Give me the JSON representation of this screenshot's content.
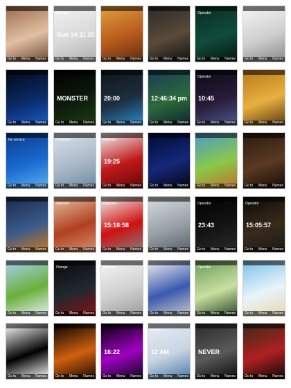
{
  "grid": {
    "tiles": [
      {
        "name": "tile-woman-bikini",
        "bg": [
          "#9a6b4c",
          "#e2c0a4",
          "#6f4a35"
        ],
        "operator": "",
        "text": "",
        "softkeys": false
      },
      {
        "name": "tile-heart-calendar",
        "bg": [
          "#f2f2f2",
          "#d9d9d9",
          "#b0b0b0"
        ],
        "operator": "Operator",
        "text": "Sun 14:11 2010",
        "softkeys": false
      },
      {
        "name": "tile-autumn-leaves",
        "bg": [
          "#e0a040",
          "#b85a1c",
          "#5a2c10"
        ],
        "operator": "",
        "text": "",
        "softkeys": false
      },
      {
        "name": "tile-matches",
        "bg": [
          "#2a2a2a",
          "#5a4a3a",
          "#111111"
        ],
        "operator": "",
        "text": "",
        "softkeys": false
      },
      {
        "name": "tile-green-clock",
        "bg": [
          "#0a2a22",
          "#0f4c3c",
          "#051510"
        ],
        "operator": "Operator",
        "text": "",
        "softkeys": false
      },
      {
        "name": "tile-paper-sketch",
        "bg": [
          "#f5f5f5",
          "#cfcfcf",
          "#8a8a8a"
        ],
        "operator": "",
        "text": "",
        "softkeys": false
      },
      {
        "name": "tile-blue-battery",
        "bg": [
          "#040814",
          "#0a2a66",
          "#1a5ccc"
        ],
        "operator": "",
        "text": "",
        "softkeys": false
      },
      {
        "name": "tile-monster-energy",
        "bg": [
          "#000000",
          "#0d1a0d",
          "#1b3d12"
        ],
        "operator": "",
        "text": "MONSTER",
        "softkeys": false
      },
      {
        "name": "tile-blue-lens",
        "bg": [
          "#101418",
          "#1d2f3f",
          "#2a8ad0"
        ],
        "operator": "",
        "text": "20:00",
        "softkeys": false
      },
      {
        "name": "tile-palm-windows",
        "bg": [
          "#1a3a55",
          "#2c6a3a",
          "#0d2230"
        ],
        "operator": "",
        "text": "12:46:34 pm",
        "softkeys": false
      },
      {
        "name": "tile-dark-skull",
        "bg": [
          "#0a0a14",
          "#2a1a3a",
          "#4a5a8a"
        ],
        "operator": "Operator",
        "text": "10:45",
        "softkeys": false
      },
      {
        "name": "tile-anime-orange",
        "bg": [
          "#b8781c",
          "#e8b040",
          "#5a3a10"
        ],
        "operator": "",
        "text": "",
        "softkeys": false
      },
      {
        "name": "tile-dolphin",
        "bg": [
          "#0a3a8a",
          "#1a6ad0",
          "#5ab0f0"
        ],
        "operator": "No service",
        "text": "",
        "softkeys": false
      },
      {
        "name": "tile-vodafone-clock",
        "bg": [
          "#d8e2ea",
          "#aab8c8",
          "#6f8aa0"
        ],
        "operator": "Vodafone",
        "text": "",
        "softkeys": false
      },
      {
        "name": "tile-red-heart",
        "bg": [
          "#f2f2f2",
          "#c01818",
          "#600808"
        ],
        "operator": "Operator",
        "text": "19:25",
        "softkeys": false
      },
      {
        "name": "tile-blue-gauges",
        "bg": [
          "#000a30",
          "#14287a",
          "#05050f"
        ],
        "operator": "",
        "text": "",
        "softkeys": false
      },
      {
        "name": "tile-fantasy-girl",
        "bg": [
          "#4a9acc",
          "#8ac84a",
          "#c0702a"
        ],
        "operator": "",
        "text": "",
        "softkeys": false
      },
      {
        "name": "tile-brown-clock",
        "bg": [
          "#2a1a10",
          "#5a3a22",
          "#140a05"
        ],
        "operator": "",
        "text": "",
        "softkeys": false
      },
      {
        "name": "tile-motorbike",
        "bg": [
          "#1a2a4a",
          "#3a5a8a",
          "#c87a20"
        ],
        "operator": "",
        "text": "",
        "softkeys": false
      },
      {
        "name": "tile-girl-redhead",
        "bg": [
          "#e8c0a0",
          "#b04020",
          "#d89070"
        ],
        "operator": "Operator",
        "text": "",
        "softkeys": false
      },
      {
        "name": "tile-ferrari",
        "bg": [
          "#f0f0f0",
          "#d01010",
          "#808080"
        ],
        "operator": "Operator",
        "text": "15:18:58",
        "softkeys": false
      },
      {
        "name": "tile-smoke-train",
        "bg": [
          "#d8dce0",
          "#9aa0a8",
          "#5a6068"
        ],
        "operator": "",
        "text": "",
        "softkeys": false
      },
      {
        "name": "tile-black-clock",
        "bg": [
          "#000000",
          "#141414",
          "#2a2a2a"
        ],
        "operator": "Operator",
        "text": "23:43",
        "softkeys": false
      },
      {
        "name": "tile-warrior",
        "bg": [
          "#0a0a0a",
          "#3a2a1a",
          "#1a1a1a"
        ],
        "operator": "Operator",
        "text": "15:05:57",
        "softkeys": false
      },
      {
        "name": "tile-grass-blue",
        "bg": [
          "#a8d0f0",
          "#6ab03a",
          "#e8f0f8"
        ],
        "operator": "",
        "text": "",
        "softkeys": false
      },
      {
        "name": "tile-speedometer",
        "bg": [
          "#0a0a0a",
          "#202830",
          "#8a1010"
        ],
        "operator": "Orange",
        "text": "",
        "softkeys": false
      },
      {
        "name": "tile-alarm-clock",
        "bg": [
          "#f5f5f5",
          "#d0d0d0",
          "#9a9a9a"
        ],
        "operator": "Operator",
        "text": "",
        "softkeys": false
      },
      {
        "name": "tile-blue-bike",
        "bg": [
          "#f0f0f0",
          "#3a5ab0",
          "#c8c8c8"
        ],
        "operator": "",
        "text": "",
        "softkeys": false
      },
      {
        "name": "tile-bubble",
        "bg": [
          "#6a9a5a",
          "#c8e0a0",
          "#2a4a2a"
        ],
        "operator": "Operator",
        "text": "",
        "softkeys": false
      },
      {
        "name": "tile-beach",
        "bg": [
          "#7ac0e8",
          "#e8f4fa",
          "#e8d8b0"
        ],
        "operator": "",
        "text": "",
        "softkeys": false
      },
      {
        "name": "tile-zebra-swirl",
        "bg": [
          "#ffffff",
          "#000000",
          "#ffffff"
        ],
        "operator": "",
        "text": "",
        "softkeys": false
      },
      {
        "name": "tile-fire-planet",
        "bg": [
          "#000000",
          "#d06010",
          "#1a0a00"
        ],
        "operator": "",
        "text": "",
        "softkeys": false
      },
      {
        "name": "tile-neon-lines",
        "bg": [
          "#05000a",
          "#a000c0",
          "#0a0a1a"
        ],
        "operator": "",
        "text": "16:22",
        "softkeys": false
      },
      {
        "name": "tile-mouse-clock",
        "bg": [
          "#e8eef5",
          "#c8d4e0",
          "#4a7ab0"
        ],
        "operator": "NOKIA",
        "text": "12 AM",
        "softkeys": false
      },
      {
        "name": "tile-never-trust",
        "bg": [
          "#2a2a2a",
          "#5a5a5a",
          "#0a0a0a"
        ],
        "operator": "",
        "text": "NEVER",
        "softkeys": false
      },
      {
        "name": "tile-angry-birds",
        "bg": [
          "#3a2a1a",
          "#b02020",
          "#0a0a0a"
        ],
        "operator": "",
        "text": "",
        "softkeys": false
      }
    ]
  },
  "softkeys": {
    "left": "Go to",
    "center": "Menu",
    "right": "Names"
  }
}
